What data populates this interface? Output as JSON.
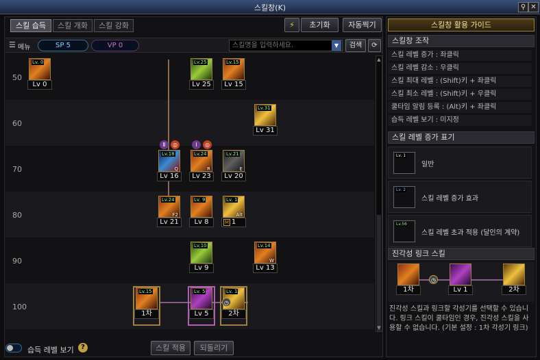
{
  "window": {
    "title": "스킬창(K)",
    "pin_icon": "pin-icon",
    "close_icon": "close-icon"
  },
  "tabs": [
    {
      "label": "스킬 습득",
      "active": true
    },
    {
      "label": "스킬 개화",
      "active": false
    },
    {
      "label": "스킬 강화",
      "active": false
    }
  ],
  "top_buttons": {
    "reset": "초기화",
    "auto": "자동찍기"
  },
  "toolbar": {
    "menu_label": "메뉴",
    "sp_label": "SP 5",
    "vp_label": "VP 0",
    "search_placeholder": "스킬명을 입력하세요.",
    "search_button": "검색"
  },
  "level_rows": [
    "50",
    "60",
    "70",
    "80",
    "90",
    "100"
  ],
  "skills": [
    {
      "row": 0,
      "col": 0,
      "cap": "Lv 0",
      "badge": "Lv. 0",
      "style": "orange"
    },
    {
      "row": 0,
      "col": 1,
      "cap": "Lv 25",
      "badge": "Lv.25",
      "style": "green"
    },
    {
      "row": 0,
      "col": 2,
      "cap": "Lv 15",
      "badge": "Lv.15",
      "style": "orange"
    },
    {
      "row": 1,
      "col": 3,
      "cap": "Lv 31",
      "badge": "Lv.31",
      "style": "gold"
    },
    {
      "row": 2,
      "col": 4,
      "cap": "Lv 16",
      "badge": "Lv.18",
      "style": "blue",
      "key": "Q"
    },
    {
      "row": 2,
      "col": 1,
      "cap": "Lv 23",
      "badge": "Lv.24",
      "style": "orange",
      "key": "R"
    },
    {
      "row": 2,
      "col": 2,
      "cap": "Lv 20",
      "badge": "Lv.21",
      "style": "dark",
      "key": "E"
    },
    {
      "row": 3,
      "col": 4,
      "cap": "Lv 21",
      "badge": "Lv.24",
      "style": "orange",
      "key": "F2"
    },
    {
      "row": 3,
      "col": 1,
      "cap": "Lv 8",
      "badge": "Lv. 9",
      "style": "orange"
    },
    {
      "row": 3,
      "col": 2,
      "cap": "1",
      "badge": "Lv. 1",
      "style": "gold",
      "key": "Alt",
      "marker": "M"
    },
    {
      "row": 4,
      "col": 1,
      "cap": "Lv 9",
      "badge": "Lv.10",
      "style": "green"
    },
    {
      "row": 4,
      "col": 3,
      "cap": "Lv 13",
      "badge": "Lv.14",
      "style": "orange",
      "key": "W"
    },
    {
      "row": 5,
      "col": 5,
      "cap": "1차",
      "badge": "Lv.15",
      "style": "orange"
    },
    {
      "row": 5,
      "col": 1,
      "cap": "Lv 5",
      "badge": "Lv. 5",
      "style": "purple"
    },
    {
      "row": 5,
      "col": 2,
      "cap": "2차",
      "badge": "Lv. 1",
      "style": "gold"
    }
  ],
  "bottom": {
    "toggle_label": "습득 레벨 보기",
    "help_icon": "?",
    "apply": "스킬 적용",
    "revert": "되돌리기"
  },
  "guide": {
    "header": "스킬창 활용 가이드",
    "section1": "스킬창 조작",
    "controls": [
      "스킬 레벨 증가 : 좌클릭",
      "스킬 레벨 감소 : 우클릭",
      "스킬 최대 레벨 : (Shift)키 + 좌클릭",
      "스킬 최소 레벨 : (Shift)키 + 우클릭",
      "쿨타임 알림 등록 : (Alt)키 + 좌클릭",
      "습득 레벨 보기 : 미지정"
    ],
    "section2": "스킬 레벨 증가 표기",
    "legend": [
      {
        "badge": "Lv. 1",
        "label": "일반",
        "color": "#ffffff"
      },
      {
        "badge": "Lv. 2",
        "label": "스킬 레벨 증가 효과",
        "color": "#7fbfff"
      },
      {
        "badge": "Lv.56",
        "label": "스킬 레벨 초과 적용 (달인의 계약)",
        "color": "#9f9"
      }
    ],
    "section3": "진각성 링크 스킬",
    "link": {
      "left": "1차",
      "mid": "Lv 1",
      "right": "2차"
    },
    "note": "진각성 스킬과 링크할 각성기를 선택할 수 있습니다. 링크 스킬이 쿨타임인 경우, 진각성 스킬을 사용할 수 없습니다. (기본 설정 : 1차 각성기 링크)"
  },
  "colors": {
    "accent": "#a08040",
    "sp": "#7fd7ff",
    "vp": "#d070d0"
  }
}
